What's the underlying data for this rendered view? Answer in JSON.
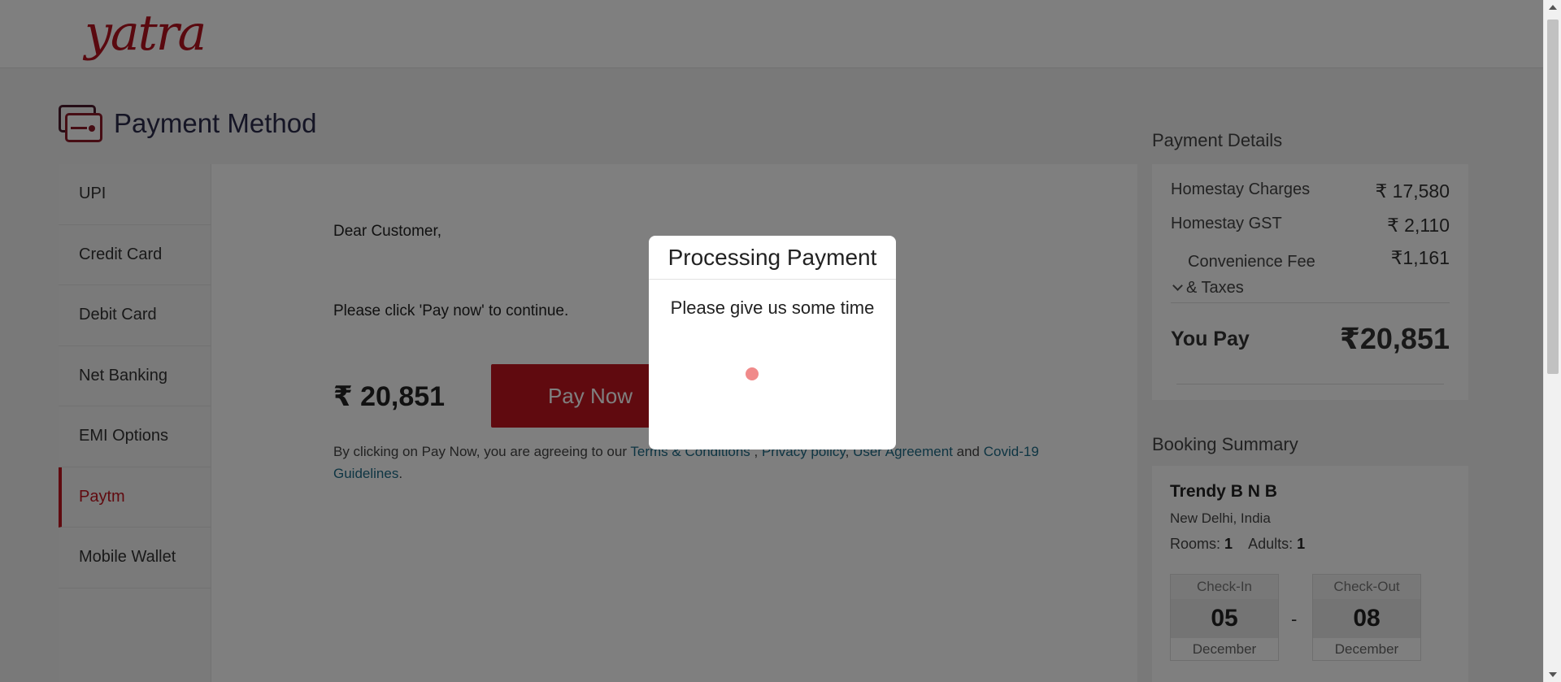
{
  "header": {
    "logo_text": "yatra"
  },
  "page": {
    "title": "Payment Method",
    "icon": "payment-card-icon"
  },
  "tabs": [
    {
      "label": "UPI",
      "active": false
    },
    {
      "label": "Credit Card",
      "active": false
    },
    {
      "label": "Debit Card",
      "active": false
    },
    {
      "label": "Net Banking",
      "active": false
    },
    {
      "label": "EMI Options",
      "active": false
    },
    {
      "label": "Paytm",
      "active": true
    },
    {
      "label": "Mobile Wallet",
      "active": false
    }
  ],
  "content": {
    "greeting": "Dear Customer,",
    "instruction": "Please click 'Pay now' to continue.",
    "amount": "₹ 20,851",
    "pay_button": "Pay Now",
    "terms_prefix": "By clicking on Pay Now, you are agreeing to our ",
    "terms_link": "Terms & Conditions",
    "sep1": " , ",
    "privacy_link": "Privacy policy",
    "sep2": ", ",
    "agreement_link": "User Agreement",
    "and_text": " and ",
    "covid_link": "Covid-19 Guidelines",
    "end": "."
  },
  "payment_details": {
    "title": "Payment Details",
    "homestay_charges_label": "Homestay Charges",
    "homestay_charges_value": "₹ 17,580",
    "homestay_gst_label": "Homestay GST",
    "homestay_gst_value": "₹ 2,110",
    "convenience_label_1": "Convenience Fee",
    "convenience_label_2": "& Taxes",
    "convenience_value": "₹1,161",
    "you_pay_label": "You Pay",
    "you_pay_value": "₹20,851"
  },
  "booking_summary": {
    "title": "Booking Summary",
    "hotel": "Trendy B N B",
    "city": "New Delhi, India",
    "rooms_label": "Rooms:",
    "rooms_value": "1",
    "adults_label": "Adults:",
    "adults_value": "1",
    "checkin_label": "Check-In",
    "checkin_day": "05",
    "checkin_month": "December",
    "checkout_label": "Check-Out",
    "checkout_day": "08",
    "checkout_month": "December",
    "separator": "-"
  },
  "modal": {
    "title": "Processing Payment",
    "message": "Please give us some time"
  },
  "colors": {
    "brand": "#c0141f",
    "link": "#1d6a86"
  }
}
